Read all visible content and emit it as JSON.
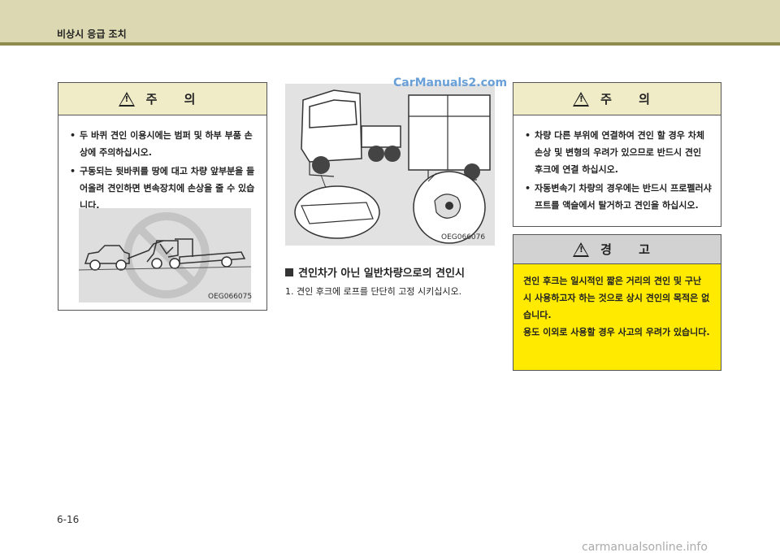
{
  "header": {
    "title": "비상시 응급 조치"
  },
  "caution_left": {
    "heading": "주 의",
    "items": [
      "두 바퀴 견인 이용시에는 범퍼 및 하부 부품 손상에 주의하십시오.",
      "구동되는 뒷바퀴를 땅에 대고 차량 앞부분을 들어올려 견인하면 변속장치에 손상을 줄 수 있습니다."
    ],
    "image_code": "OEG066075"
  },
  "center": {
    "watermark": "CarManuals2.com",
    "image_code": "OEG066076",
    "section_title": "견인차가 아닌 일반차량으로의 견인시",
    "step": "1.  견인 후크에 로프를 단단히 고정 시키십시오."
  },
  "caution_right": {
    "heading": "주 의",
    "items": [
      "차량 다른 부위에 연결하여 견인 할 경우 차체 손상 및 변형의 우려가 있으므로 반드시 견인 후크에 연결 하십시오.",
      "자동변속기 차량의 경우에는 반드시 프로펠러샤프트를 액슬에서 탈거하고 견인을 하십시오."
    ]
  },
  "warning": {
    "heading": "경 고",
    "lines": [
      "견인 후크는 일시적인 짧은 거리의 견인 및 구난 시 사용하고자 하는 것으로 상시 견인의 목적은 없습니다.",
      "용도 이외로 사용할 경우 사고의 우려가 있습니다."
    ],
    "background_color": "#ffea00"
  },
  "footer": {
    "page_number": "6-16",
    "source_mark": "carmanualsonline.info"
  }
}
